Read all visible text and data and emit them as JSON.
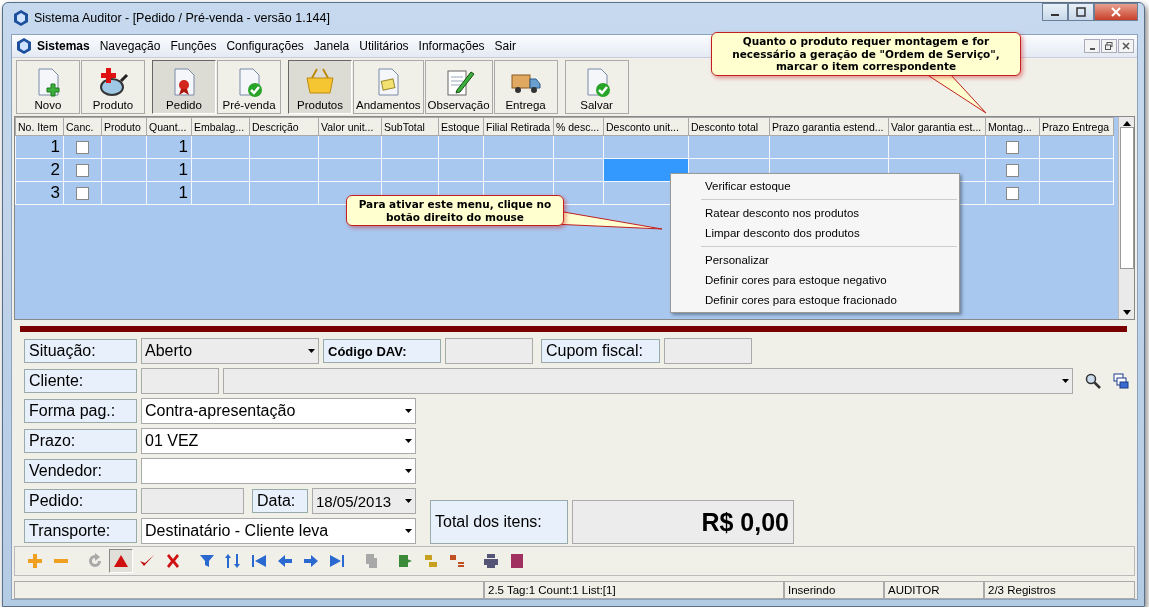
{
  "window": {
    "title": "Sistema Auditor - [Pedido / Pré-venda - versão 1.144]"
  },
  "menu": [
    {
      "label": "Sistemas",
      "bold": true
    },
    {
      "label": "Navegação",
      "bold": false
    },
    {
      "label": "Funções",
      "bold": false
    },
    {
      "label": "Configurações",
      "bold": false
    },
    {
      "label": "Janela",
      "bold": false
    },
    {
      "label": "Utilitários",
      "bold": false
    },
    {
      "label": "Informações",
      "bold": false
    },
    {
      "label": "Sair",
      "bold": false
    }
  ],
  "toolbar_groups": [
    [
      {
        "kind": "new",
        "label": "Novo",
        "selected": false
      },
      {
        "kind": "product",
        "label": "Produto",
        "selected": false
      }
    ],
    [
      {
        "kind": "order",
        "label": "Pedido",
        "selected": true
      },
      {
        "kind": "presale",
        "label": "Pré-venda",
        "selected": false
      }
    ],
    [
      {
        "kind": "basket",
        "label": "Produtos",
        "selected": true
      },
      {
        "kind": "progress",
        "label": "Andamentos",
        "selected": false
      },
      {
        "kind": "note",
        "label": "Observação",
        "selected": false
      },
      {
        "kind": "delivery",
        "label": "Entrega",
        "selected": false
      }
    ],
    [
      {
        "kind": "save",
        "label": "Salvar",
        "selected": false
      }
    ]
  ],
  "grid": {
    "columns": [
      "No. Item",
      "Canc.",
      "Produto",
      "Quant...",
      "Embalag...",
      "Descrição",
      "Valor unit...",
      "SubTotal",
      "Estoque",
      "Filial Retirada",
      "% desc...",
      "Desconto unit...",
      "Desconto total",
      "Prazo garantia estend...",
      "Valor garantia est...",
      "Montag...",
      "Prazo Entrega"
    ],
    "rows": [
      {
        "item": "1",
        "canceled": false,
        "quantity": "1",
        "assembly": false,
        "selected": false
      },
      {
        "item": "2",
        "canceled": false,
        "quantity": "1",
        "assembly": false,
        "selected": true
      },
      {
        "item": "3",
        "canceled": false,
        "quantity": "1",
        "assembly": false,
        "selected": false
      }
    ]
  },
  "context_menu_groups": [
    [
      "Verificar estoque"
    ],
    [
      "Ratear desconto nos produtos",
      "Limpar desconto dos produtos"
    ],
    [
      "Personalizar",
      "Definir cores para estoque negativo",
      "Definir cores para estoque fracionado"
    ]
  ],
  "callouts": [
    {
      "text": "Quanto o produto requer montagem e for necessário a geração de \"Ordem de Serviço\", marcar o item correspondente"
    },
    {
      "text": "Para ativar este menu, clique no botão direito do mouse"
    }
  ],
  "form": {
    "situacao": {
      "label": "Situação:",
      "value": "Aberto",
      "disabled": true
    },
    "codigo_dav": {
      "label": "Código DAV:"
    },
    "cupom_fiscal": {
      "label": "Cupom fiscal:"
    },
    "cliente": {
      "label": "Cliente:"
    },
    "forma_pag": {
      "label": "Forma pag.:",
      "value": "Contra-apresentação",
      "disabled": false
    },
    "prazo": {
      "label": "Prazo:",
      "value": "01 VEZ",
      "disabled": false
    },
    "vendedor": {
      "label": "Vendedor:",
      "disabled": false
    },
    "pedido": {
      "label": "Pedido:"
    },
    "data": {
      "label": "Data:",
      "value": "18/05/2013",
      "disabled": true
    },
    "transporte": {
      "label": "Transporte:",
      "value": "Destinatário - Cliente leva",
      "disabled": false
    },
    "total": {
      "label": "Total dos itens:",
      "value": "R$ 0,00"
    }
  },
  "nav_toolbar_groups": [
    [
      {
        "kind": "add",
        "disabled": false,
        "pressed": false
      },
      {
        "kind": "remove",
        "disabled": false,
        "pressed": false
      }
    ],
    [
      {
        "kind": "refresh",
        "disabled": true,
        "pressed": false
      },
      {
        "kind": "edit",
        "disabled": false,
        "pressed": true
      },
      {
        "kind": "confirm",
        "disabled": false,
        "pressed": false
      },
      {
        "kind": "cancel",
        "disabled": false,
        "pressed": false
      }
    ],
    [
      {
        "kind": "filter",
        "disabled": false,
        "pressed": false
      },
      {
        "kind": "sort",
        "disabled": false,
        "pressed": false
      },
      {
        "kind": "first",
        "disabled": false,
        "pressed": false
      },
      {
        "kind": "prev",
        "disabled": false,
        "pressed": false
      },
      {
        "kind": "next",
        "disabled": false,
        "pressed": false
      },
      {
        "kind": "last",
        "disabled": false,
        "pressed": false
      }
    ],
    [
      {
        "kind": "copy",
        "disabled": true,
        "pressed": false
      }
    ],
    [
      {
        "kind": "export",
        "disabled": false,
        "pressed": false
      },
      {
        "kind": "import",
        "disabled": false,
        "pressed": false
      },
      {
        "kind": "list",
        "disabled": false,
        "pressed": false
      }
    ],
    [
      {
        "kind": "print",
        "disabled": false,
        "pressed": false
      },
      {
        "kind": "report",
        "disabled": false,
        "pressed": false
      }
    ]
  ],
  "status_bar": [
    "2.5 Tag:1 Count:1 List:[1]",
    "Inserindo",
    "AUDITOR",
    "2/3 Registros"
  ]
}
